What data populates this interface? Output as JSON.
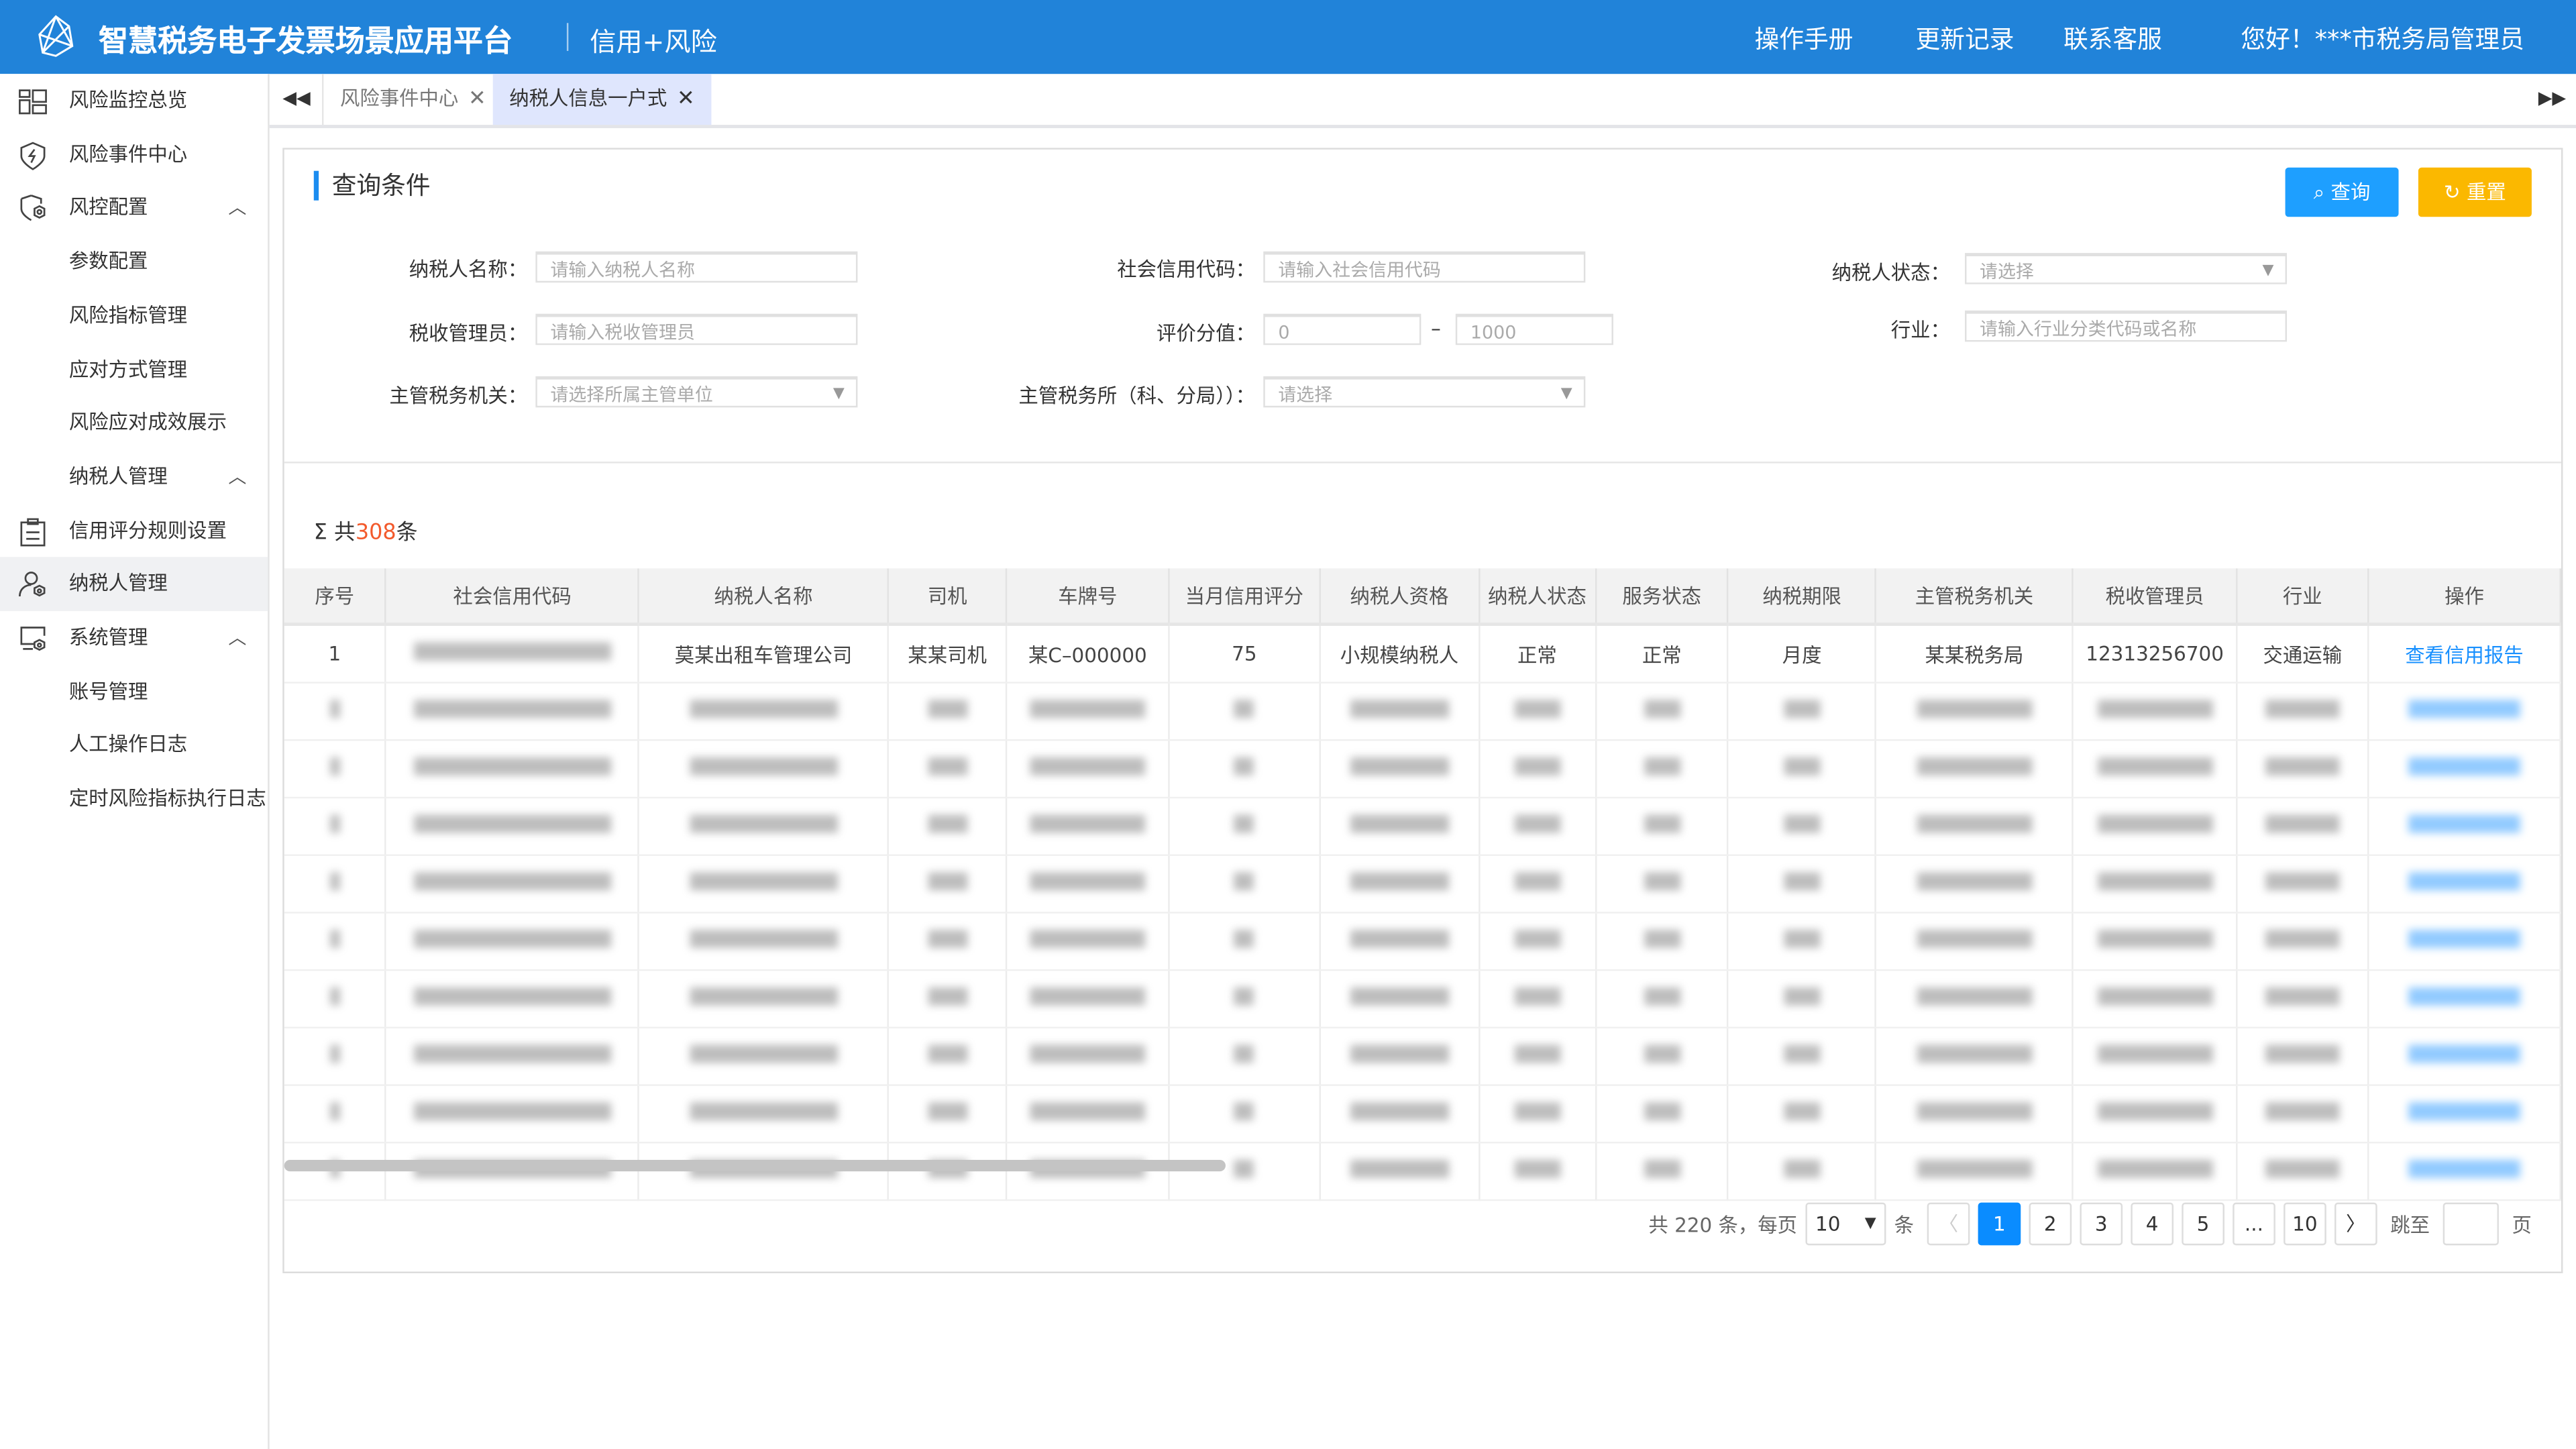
{
  "header": {
    "title": "智慧税务电子发票场景应用平台",
    "subtitle": "信用+风险",
    "links": [
      "操作手册",
      "更新记录",
      "联系客服"
    ],
    "greeting": "您好！***市税务局管理员",
    "bg_color": "#2183d9"
  },
  "sidebar": {
    "items": [
      {
        "label": "风险监控总览",
        "icon": "dashboard-icon"
      },
      {
        "label": "风险事件中心",
        "icon": "shield-lightning-icon"
      },
      {
        "label": "风控配置",
        "icon": "shield-gear-icon",
        "expanded": true
      },
      {
        "label": "参数配置"
      },
      {
        "label": "风险指标管理"
      },
      {
        "label": "应对方式管理"
      },
      {
        "label": "风险应对成效展示"
      },
      {
        "label": "纳税人管理",
        "expanded": true
      },
      {
        "label": "信用评分规则设置",
        "icon": "clipboard-icon"
      },
      {
        "label": "纳税人管理",
        "icon": "user-gear-icon",
        "active": true
      },
      {
        "label": "系统管理",
        "icon": "monitor-gear-icon",
        "expanded": true
      },
      {
        "label": "账号管理"
      },
      {
        "label": "人工操作日志"
      },
      {
        "label": "定时风险指标执行日志"
      }
    ]
  },
  "tabs": [
    {
      "label": "风险事件中心"
    },
    {
      "label": "纳税人信息一户式",
      "active": true
    }
  ],
  "query": {
    "title": "查询条件",
    "search_label": "查询",
    "reset_label": "重置",
    "fields": {
      "name": {
        "label": "纳税人名称：",
        "placeholder": "请输入纳税人名称"
      },
      "credit_code": {
        "label": "社会信用代码：",
        "placeholder": "请输入社会信用代码"
      },
      "status": {
        "label": "纳税人状态：",
        "placeholder": "请选择"
      },
      "manager": {
        "label": "税收管理员：",
        "placeholder": "请输入税收管理员"
      },
      "score": {
        "label": "评价分值：",
        "min": "0",
        "dash": "–",
        "max": "1000"
      },
      "industry": {
        "label": "行业：",
        "placeholder": "请输入行业分类代码或名称"
      },
      "authority": {
        "label": "主管税务机关：",
        "placeholder": "请选择所属主管单位"
      },
      "office": {
        "label": "主管税务所（科、分局））：",
        "placeholder": "请选择"
      }
    }
  },
  "summary": {
    "sigma": "Σ",
    "prefix": "共",
    "count": "308",
    "suffix": "条"
  },
  "table": {
    "columns": [
      "序号",
      "社会信用代码",
      "纳税人名称",
      "司机",
      "车牌号",
      "当月信用评分",
      "纳税人资格",
      "纳税人状态",
      "服务状态",
      "纳税期限",
      "主管税务机关",
      "税收管理员",
      "行业",
      "操作"
    ],
    "first_row": [
      "1",
      "",
      "莫某出租车管理公司",
      "某某司机",
      "某C–000000",
      "75",
      "小规模纳税人",
      "正常",
      "正常",
      "月度",
      "某某税务局",
      "12313256700",
      "交通运输",
      "查看信用报告"
    ],
    "blurred_rows": 9
  },
  "pagination": {
    "total_text": "共 220 条，每页",
    "page_size": "10",
    "unit": "条",
    "pages": [
      "1",
      "2",
      "3",
      "4",
      "5",
      "...",
      "10"
    ],
    "current": "1",
    "jump_label": "跳至",
    "page_label": "页"
  }
}
